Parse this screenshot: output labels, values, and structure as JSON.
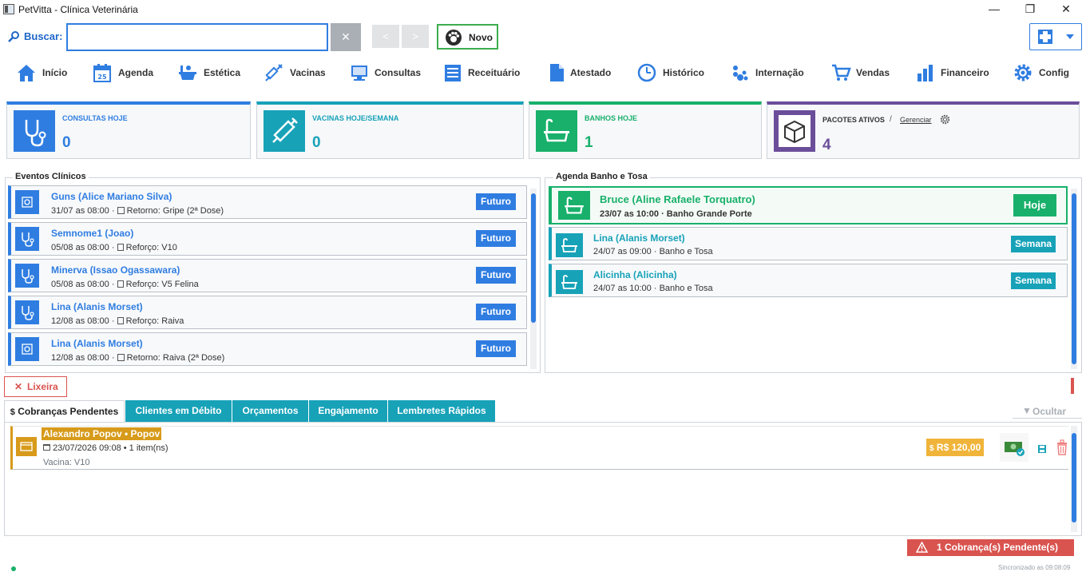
{
  "window": {
    "title": "PetVitta - Clínica Veterinária",
    "minimize": "—",
    "maximize": "❐",
    "close": "✕"
  },
  "search": {
    "label": "Buscar:",
    "value": "",
    "clear": "✕",
    "prev": "<",
    "next": ">",
    "new_label": "Novo"
  },
  "menu": [
    {
      "label": "Início",
      "icon": "home-icon"
    },
    {
      "label": "Agenda",
      "icon": "calendar-icon",
      "badge": "25"
    },
    {
      "label": "Estética",
      "icon": "bathtub-icon"
    },
    {
      "label": "Vacinas",
      "icon": "syringe-icon"
    },
    {
      "label": "Consultas",
      "icon": "monitor-icon"
    },
    {
      "label": "Receituário",
      "icon": "list-icon"
    },
    {
      "label": "Atestado",
      "icon": "document-icon"
    },
    {
      "label": "Histórico",
      "icon": "clock-icon"
    },
    {
      "label": "Internação",
      "icon": "paw-icon"
    },
    {
      "label": "Vendas",
      "icon": "cart-icon"
    },
    {
      "label": "Financeiro",
      "icon": "bar-chart-icon"
    },
    {
      "label": "Config",
      "icon": "gear-icon"
    }
  ],
  "cards": [
    {
      "label": "CONSULTAS HOJE",
      "value": "0",
      "color": "#2f7de1"
    },
    {
      "label": "VACINAS HOJE/SEMANA",
      "value": "0",
      "color": "#17a2b8"
    },
    {
      "label": "BANHOS HOJE",
      "value": "1",
      "color": "#18b06b"
    },
    {
      "label": "PACOTES ATIVOS",
      "value": "4",
      "color": "#6b4e9a",
      "separator": "/",
      "manage": "Gerenciar"
    }
  ],
  "events": {
    "title": "Eventos Clínicos",
    "items": [
      {
        "name": "Guns (Alice Mariano Silva)",
        "date": "31/07 as 08:00",
        "detail": "Retorno: Gripe (2ª Dose)",
        "badge": "Futuro",
        "type": "retorno"
      },
      {
        "name": "Semnome1 (Joao)",
        "date": "05/08 as 08:00",
        "detail": "Reforço: V10",
        "badge": "Futuro",
        "type": "reforco"
      },
      {
        "name": "Minerva (Issao Ogassawara)",
        "date": "05/08 as 08:00",
        "detail": "Reforço: V5 Felina",
        "badge": "Futuro",
        "type": "reforco"
      },
      {
        "name": "Lina (Alanis Morset)",
        "date": "12/08 as 08:00",
        "detail": "Reforço: Raiva",
        "badge": "Futuro",
        "type": "reforco"
      },
      {
        "name": "Lina (Alanis Morset)",
        "date": "12/08 as 08:00",
        "detail": "Retorno: Raiva (2ª Dose)",
        "badge": "Futuro",
        "type": "retorno"
      }
    ]
  },
  "baths": {
    "title": "Agenda Banho e Tosa",
    "items": [
      {
        "name": "Bruce (Aline Rafaele Torquatro)",
        "date": "23/07 as 10:00",
        "service": "Banho Grande Porte",
        "badge": "Hoje"
      },
      {
        "name": "Lina (Alanis Morset)",
        "date": "24/07 as 09:00",
        "service": "Banho e Tosa",
        "badge": "Semana"
      },
      {
        "name": "Alicinha (Alicinha)",
        "date": "24/07 as 10:00",
        "service": "Banho e Tosa",
        "badge": "Semana"
      }
    ]
  },
  "trash": {
    "label": "Lixeira",
    "icon": "✕"
  },
  "tabs": [
    {
      "label": "Cobranças Pendentes",
      "icon": "$",
      "active": true
    },
    {
      "label": "Clientes em Débito",
      "active": false
    },
    {
      "label": "Orçamentos",
      "active": false
    },
    {
      "label": "Engajamento",
      "active": false
    },
    {
      "label": "Lembretes Rápidos",
      "active": false
    }
  ],
  "hide": {
    "label": "Ocultar",
    "icon": "▼"
  },
  "charges": [
    {
      "client": "Alexandro Popov • Popov",
      "datetime": "23/07/2026 09:08 • 1 item(ns)",
      "item": "Vacina: V10",
      "amount": "R$ 120,00"
    }
  ],
  "status": {
    "pending_label": "1 Cobrança(s) Pendente(s)",
    "sync": "Sincronizado as 09:08:09"
  },
  "colors": {
    "accent": "#2f7de1",
    "teal": "#17a2b8",
    "green": "#18b06b",
    "purple": "#6b4e9a",
    "gold": "#d79a1a",
    "danger": "#d9534f"
  }
}
